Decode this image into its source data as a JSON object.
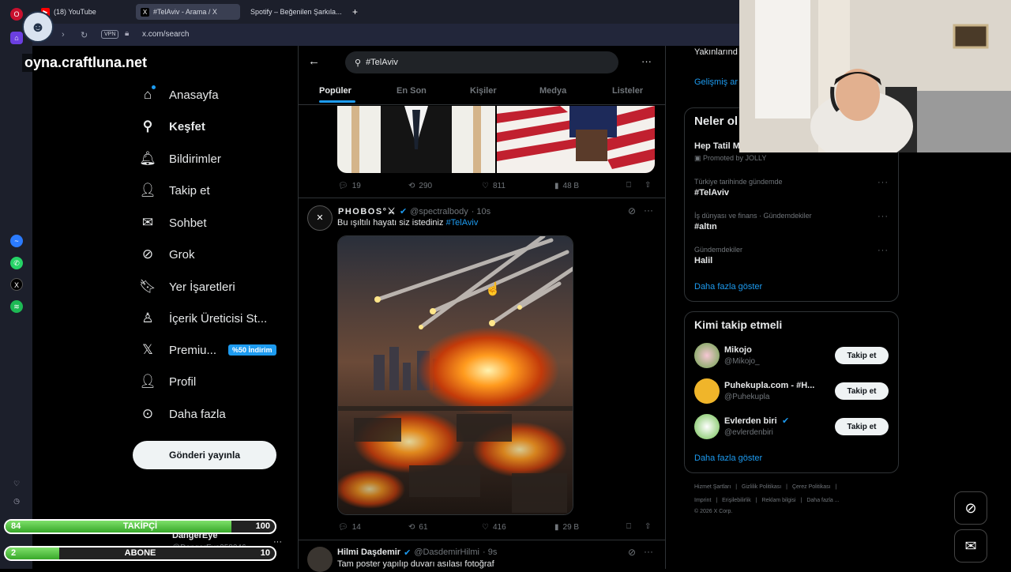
{
  "browser": {
    "tabs": [
      {
        "label": "(18) YouTube",
        "icon": "youtube-icon",
        "active": false
      },
      {
        "label": "#TelAviv - Arama / X",
        "icon": "x-logo-icon",
        "active": true
      },
      {
        "label": "Spotify – Beğenilen Şarkıla...",
        "icon": "spotify-icon",
        "active": false
      }
    ],
    "new_tab": "+",
    "vpn": "VPN",
    "url": "x.com/search"
  },
  "overlay": {
    "brand": "oyna.craftluna.net",
    "followers_label": "TAKİPÇİ",
    "followers_current": "84",
    "followers_goal": "100",
    "followers_progress": 0.84,
    "subs_label": "ABONE",
    "subs_current": "2",
    "subs_goal": "10",
    "subs_progress": 0.2
  },
  "nav": {
    "items": [
      {
        "label": "Anasayfa",
        "icon": "home-icon"
      },
      {
        "label": "Keşfet",
        "icon": "search-icon"
      },
      {
        "label": "Bildirimler",
        "icon": "bell-icon"
      },
      {
        "label": "Takip et",
        "icon": "person-add-icon"
      },
      {
        "label": "Sohbet",
        "icon": "mail-icon"
      },
      {
        "label": "Grok",
        "icon": "grok-icon"
      },
      {
        "label": "Yer İşaretleri",
        "icon": "bookmark-icon"
      },
      {
        "label": "İçerik Üreticisi St...",
        "icon": "creator-icon"
      },
      {
        "label": "Premiu...",
        "icon": "x-logo-icon"
      },
      {
        "label": "Profil",
        "icon": "person-icon"
      },
      {
        "label": "Daha fazla",
        "icon": "more-circle-icon"
      }
    ],
    "premium_badge": "%50 İndirim",
    "post_button": "Gönderi yayınla",
    "account_name": "DangerEye",
    "account_handle": "@DangerEye258246"
  },
  "search": {
    "query": "#TelAviv",
    "tabs": [
      "Popüler",
      "En Son",
      "Kişiler",
      "Medya",
      "Listeler"
    ]
  },
  "tweets": [
    {
      "stats": {
        "replies": "19",
        "reposts": "290",
        "likes": "811",
        "views": "48 B"
      }
    },
    {
      "name": "PHOBOS°⚔",
      "handle": "@spectralbody",
      "time": "· 10s",
      "text": "Bu ışıltılı hayatı siz istediniz",
      "hashtag": "#TelAviv",
      "avatar": "✕",
      "stats": {
        "replies": "14",
        "reposts": "61",
        "likes": "416",
        "views": "29 B"
      }
    },
    {
      "name": "Hilmi Daşdemir",
      "handle": "@DasdemirHilmi",
      "time": "· 9s",
      "text": "Tam poster yapılıp duvarı asılası fotoğraf"
    }
  ],
  "right": {
    "top_partial": "Yakınlarınd",
    "advanced_search": "Gelişmiş ar",
    "trends_title": "Neler ol",
    "promoted_title": "Hep Tatil M",
    "promoted_by": "Promoted by JOLLY",
    "trends": [
      {
        "context": "Türkiye tarihinde gündemde",
        "topic": "#TelAviv"
      },
      {
        "context": "İş dünyası ve finans · Gündemdekiler",
        "topic": "#altın"
      },
      {
        "context": "Gündemdekiler",
        "topic": "Halil"
      }
    ],
    "show_more": "Daha fazla göster",
    "who_to_follow_title": "Kimi takip etmeli",
    "suggestions": [
      {
        "name": "Mikojo",
        "handle": "@Mikojo_",
        "verified": false
      },
      {
        "name": "Puhekupla.com - #H...",
        "handle": "@Puhekupla",
        "verified": false
      },
      {
        "name": "Evlerden biri",
        "handle": "@evlerdenbiri",
        "verified": true
      }
    ],
    "follow_label": "Takip et",
    "footer_row1": [
      "Hizmet Şartları",
      "|",
      "Gizlilik Politikası",
      "|",
      "Çerez Politikası",
      "|"
    ],
    "footer_row2": [
      "Imprint",
      "|",
      "Erişilebilirlik",
      "|",
      "Reklam bilgisi",
      "|",
      "Daha fazla ..."
    ],
    "copyright": "© 2026 X Corp."
  },
  "colors": {
    "accent": "#1d9bf0",
    "background": "#000000",
    "text_primary": "#e7e9ea",
    "text_secondary": "#71767b",
    "progress_green": "#5cc94a"
  }
}
